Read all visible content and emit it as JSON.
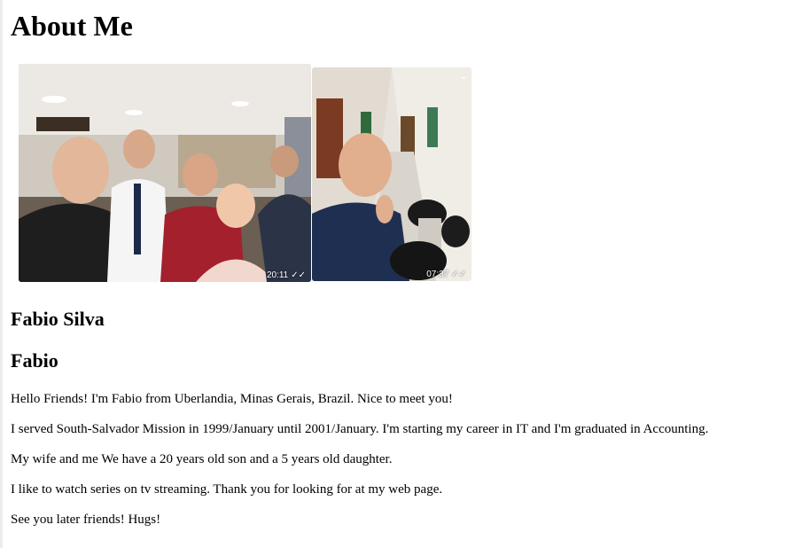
{
  "page": {
    "title": "About Me"
  },
  "photos": [
    {
      "timestamp": "20:11",
      "status_icon": "double-check-icon"
    },
    {
      "timestamp": "07:37",
      "status_icon": "double-check-icon",
      "menu_icon": "chevron-down-icon"
    }
  ],
  "profile": {
    "full_name": "Fabio Silva",
    "short_name": "Fabio"
  },
  "paragraphs": [
    "Hello Friends! I'm Fabio from Uberlandia, Minas Gerais, Brazil. Nice to meet you!",
    "I served South-Salvador Mission in 1999/January until 2001/January. I'm starting my career in IT and I'm graduated in Accounting.",
    "My wife and me We have a 20 years old son and a 5 years old daughter.",
    "I like to watch series on tv streaming. Thank you for looking for at my web page.",
    "See you later friends! Hugs!"
  ]
}
